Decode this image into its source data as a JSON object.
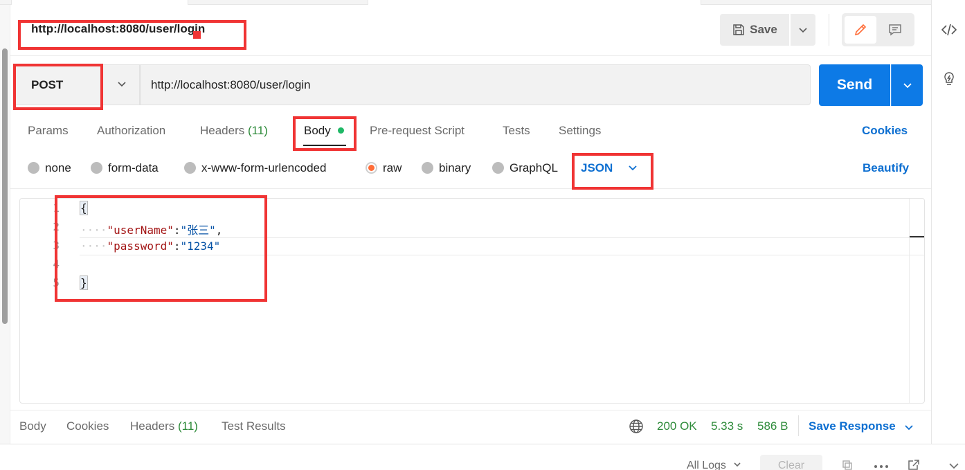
{
  "request": {
    "title": "http://localhost:8080/user/login",
    "method": "POST",
    "url": "http://localhost:8080/user/login",
    "save_label": "Save",
    "send_label": "Send"
  },
  "request_tabs": {
    "params": "Params",
    "authorization": "Authorization",
    "headers": "Headers",
    "headers_count": "(11)",
    "body": "Body",
    "pre_request": "Pre-request Script",
    "tests": "Tests",
    "settings": "Settings",
    "cookies": "Cookies"
  },
  "body_types": {
    "none": "none",
    "form_data": "form-data",
    "urlencoded": "x-www-form-urlencoded",
    "raw": "raw",
    "binary": "binary",
    "graphql": "GraphQL",
    "format": "JSON",
    "beautify": "Beautify",
    "selected": "raw"
  },
  "editor": {
    "line_numbers": [
      "1",
      "2",
      "3",
      "4",
      "5"
    ],
    "open_brace": "{",
    "close_brace": "}",
    "indent": "····",
    "line2_key": "\"userName\"",
    "line2_value": "\"张三\"",
    "line3_key": "\"password\"",
    "line3_value": "\"1234\"",
    "colon": ":",
    "comma": ","
  },
  "response_tabs": {
    "body": "Body",
    "cookies": "Cookies",
    "headers": "Headers",
    "headers_count": "(11)",
    "test_results": "Test Results"
  },
  "response_status": {
    "code": "200 OK",
    "time": "5.33 s",
    "size": "586 B",
    "save_response": "Save Response"
  },
  "console": {
    "all_logs": "All Logs",
    "clear": "Clear"
  },
  "colors": {
    "accent_blue": "#0d7ae6",
    "link_blue": "#0d6fd1",
    "success_green": "#2e8b3a",
    "active_radio": "#ff6c37",
    "annotation_red": "#f03434"
  }
}
